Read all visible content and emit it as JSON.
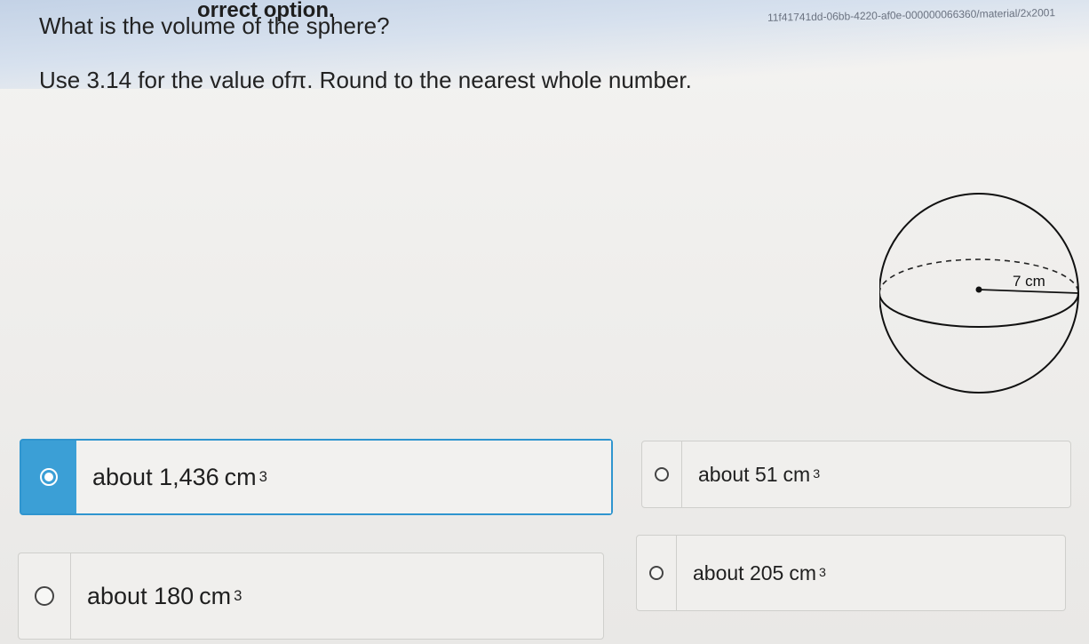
{
  "header": {
    "instruction_fragment": "orrect option.",
    "url_fragment": "11f41741dd-06bb-4220-af0e-000000066360/material/2x2001"
  },
  "question": {
    "title": "What is the volume of the sphere?",
    "instructions": "Use 3.14 for the value ofπ. Round to the nearest whole number."
  },
  "figure": {
    "radius_label": "7 cm"
  },
  "options": [
    {
      "prefix": "about",
      "value": "1,436",
      "unit": "cm",
      "exponent": "3",
      "selected": true
    },
    {
      "prefix": "about",
      "value": "51",
      "unit": "cm",
      "exponent": "3",
      "selected": false
    },
    {
      "prefix": "about",
      "value": "180",
      "unit": "cm",
      "exponent": "3",
      "selected": false
    },
    {
      "prefix": "about",
      "value": "205",
      "unit": "cm",
      "exponent": "3",
      "selected": false
    }
  ],
  "colors": {
    "selected_accent": "#3b9fd6",
    "page_background": "#eeedeb"
  }
}
